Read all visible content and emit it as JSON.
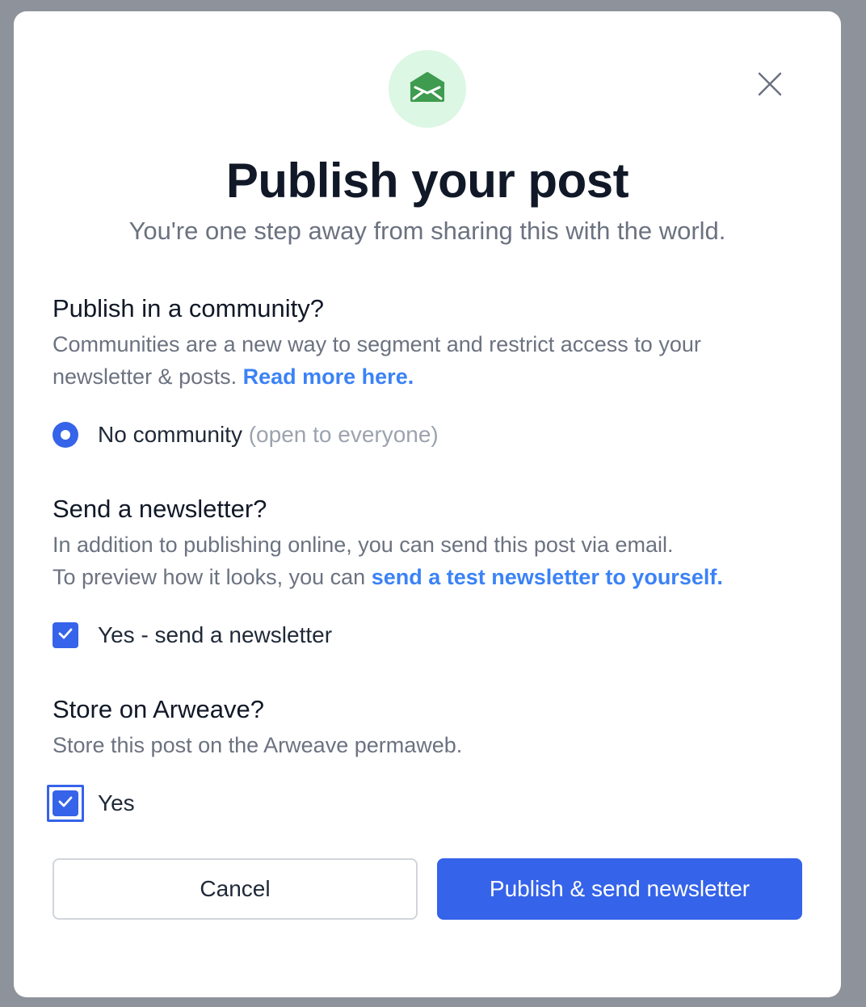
{
  "dialog": {
    "icon": "envelope-open-icon",
    "title": "Publish your post",
    "subtitle": "You're one step away from sharing this with the world.",
    "close_icon": "close-icon"
  },
  "community": {
    "heading": "Publish in a community?",
    "description": "Communities are a new way to segment and restrict access to your newsletter & posts.",
    "link": "Read more here.",
    "option_label": "No community",
    "option_hint": "(open to everyone)",
    "option_selected": true
  },
  "newsletter": {
    "heading": "Send a newsletter?",
    "description_line1": "In addition to publishing online, you can send this post via email.",
    "description_line2": "To preview how it looks, you can",
    "link": "send a test newsletter to yourself.",
    "option_label": "Yes - send a newsletter",
    "checked": true
  },
  "arweave": {
    "heading": "Store on Arweave?",
    "description": "Store this post on the Arweave permaweb.",
    "option_label": "Yes",
    "checked": true
  },
  "actions": {
    "cancel_label": "Cancel",
    "publish_label": "Publish & send newsletter"
  },
  "colors": {
    "primary": "#3563e9",
    "link": "#3b82f6",
    "icon_green": "#3f9b4f",
    "icon_bg": "#dcf7e3",
    "overlay": "#8e929b"
  }
}
